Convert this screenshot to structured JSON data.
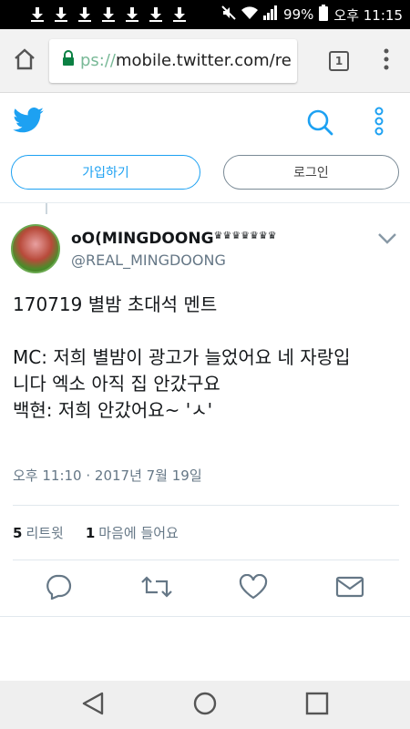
{
  "status_bar": {
    "battery": "99%",
    "time": "오후 11:15",
    "download_icon_count": 7
  },
  "browser": {
    "url_scheme_fragment": "ps://",
    "url_host": "mobile.twitter.com/re",
    "tab_count": "1"
  },
  "twitter_header": {
    "signup_label": "가입하기",
    "login_label": "로그인",
    "brand_color": "#1da1f2"
  },
  "tweet": {
    "display_name": "oO(MINGDOONG",
    "handle": "@REAL_MINGDOONG",
    "text_line1": "170719 별밤 초대석 멘트",
    "text_line2": "MC: 저희 별밤이 광고가 늘었어요 네 자랑입",
    "text_line3": "니다 엑소 아직 집 안갔구요",
    "text_line4": "백현: 저희 안갔어요~ 'ㅅ'",
    "timestamp": "오후 11:10 · 2017년 7월 19일",
    "retweet_count": "5",
    "retweet_label": "리트윗",
    "like_count": "1",
    "like_label": "마음에 들어요"
  },
  "icons": [
    "download-icon",
    "mute-icon",
    "wifi-icon",
    "signal-icon",
    "battery-icon",
    "home-icon",
    "lock-icon",
    "tabs-icon",
    "overflow-menu-icon",
    "twitter-bird-icon",
    "search-icon",
    "more-icon",
    "chevron-down-icon",
    "reply-icon",
    "retweet-icon",
    "like-icon",
    "message-icon",
    "back-icon",
    "home-nav-icon",
    "recents-icon"
  ]
}
